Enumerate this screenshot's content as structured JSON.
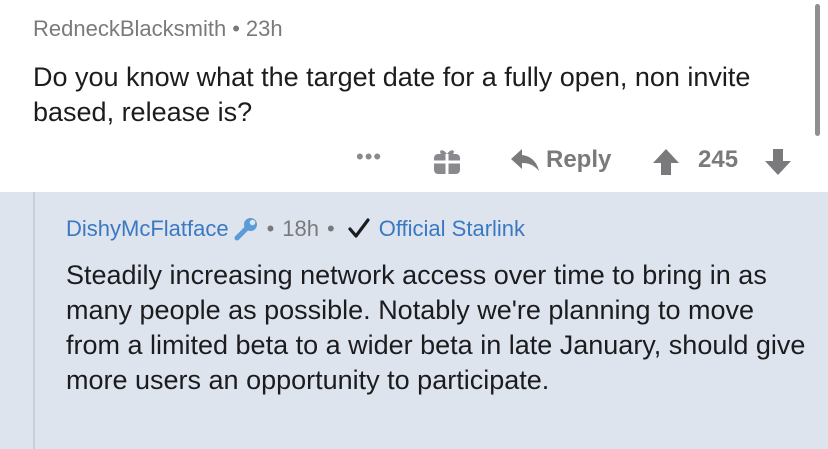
{
  "parent_comment": {
    "author": "RedneckBlacksmith",
    "separator": "•",
    "age": "23h",
    "text": "Do you know what the target date for a fully open,  non invite based,  release is?",
    "actions": {
      "more": "•••",
      "reply_label": "Reply",
      "score": "245"
    }
  },
  "reply_comment": {
    "author": "DishyMcFlatface",
    "separator": "•",
    "age": "18h",
    "flair": "Official Starlink",
    "text": "Steadily increasing network access over time to bring in as many people as possible.  Notably we're planning to move from a limited beta to a wider beta in late January, should give more users an opportunity to participate."
  },
  "colors": {
    "link_blue": "#3a79c2",
    "meta_gray": "#7a7a7c",
    "reply_bg": "#dde4ee"
  },
  "icons": [
    "gift-icon",
    "reply-arrow-icon",
    "upvote-icon",
    "downvote-icon",
    "wrench-icon",
    "checkmark-icon"
  ]
}
